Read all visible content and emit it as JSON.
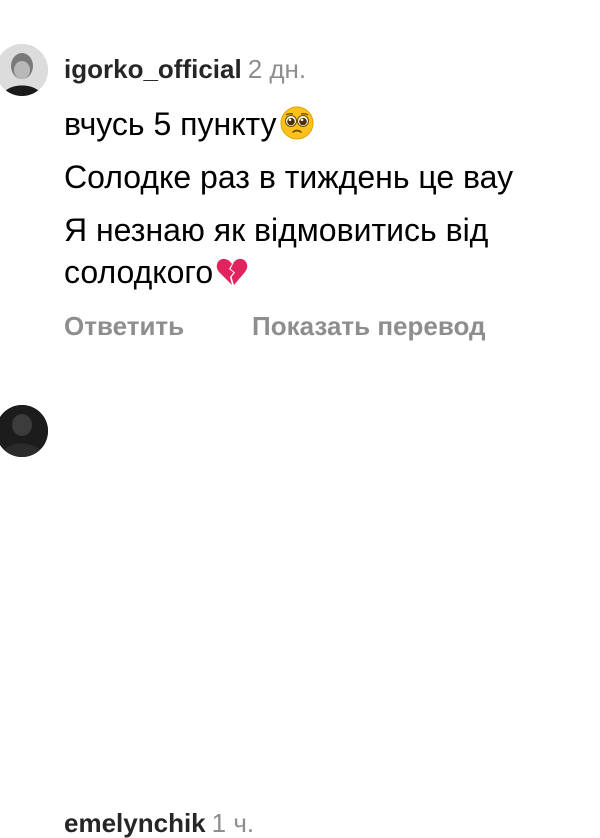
{
  "comments": [
    {
      "username": "igorko_official",
      "time": "2 дн.",
      "lines": [
        "вчусь 5 пункту",
        "Солодке раз в тиждень це вау",
        "Я незнаю як відмовитись від",
        "солодкого"
      ],
      "emoji": [
        "pleading-face-emoji",
        "broken-heart-emoji"
      ],
      "actions": {
        "reply": "Ответить",
        "translate": "Показать перевод"
      }
    },
    {
      "username": "emelynchik",
      "time": "1 ч."
    }
  ],
  "colors": {
    "username": "#262626",
    "secondary": "#8e8e8e",
    "heart": "#e0245e"
  }
}
